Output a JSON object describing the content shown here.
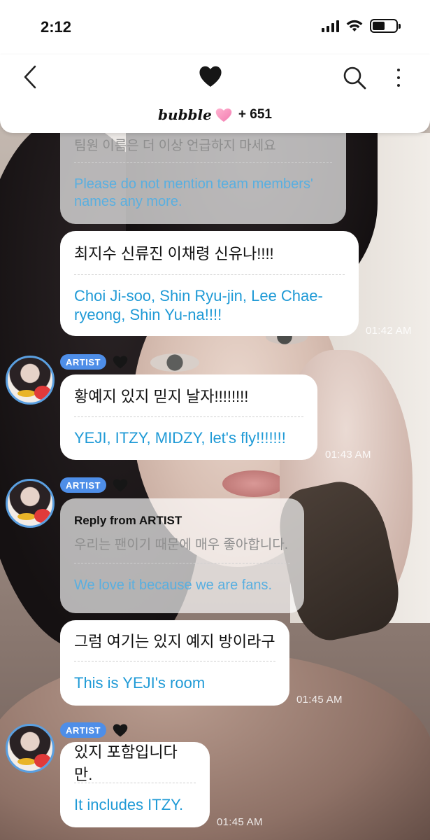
{
  "status": {
    "time": "2:12",
    "battery_level": 0.52
  },
  "header": {
    "brand": "bubble",
    "count": "+ 651",
    "icons": [
      "back-chevron-icon",
      "black-heart-icon",
      "search-icon",
      "more-vertical-icon",
      "pink-heart-icon"
    ]
  },
  "colors": {
    "accent": "#1f9ad6",
    "badge": "#4e8ee8",
    "avatar_ring": "#5a9fe0"
  },
  "messages": [
    {
      "ko": "팀원 이름은 더 이상 언급하지 마세요",
      "en": "Please do not mention team members' names any more."
    },
    {
      "ko": "최지수 신류진 이채령 신유나!!!!",
      "en": "Choi Ji-soo, Shin Ryu-jin, Lee Chae-ryeong, Shin Yu-na!!!!",
      "time": "01:42 AM"
    },
    {
      "badge": "ARTIST",
      "ko": "황예지 있지 믿지 날자!!!!!!!!",
      "en": "YEJI, ITZY, MIDZY, let's fly!!!!!!!",
      "time": "01:43 AM"
    },
    {
      "badge": "ARTIST",
      "reply_label": "Reply from ARTIST",
      "ko": "우리는 팬이기 때문에 매우 좋아합니다.",
      "en": "We love it because we are fans."
    },
    {
      "ko": "그럼 여기는 있지 예지 방이라구",
      "en": "This is YEJI's room",
      "time": "01:45 AM"
    },
    {
      "badge": "ARTIST",
      "ko": "있지 포함입니다만.",
      "en": "It includes ITZY.",
      "time": "01:45 AM"
    }
  ]
}
